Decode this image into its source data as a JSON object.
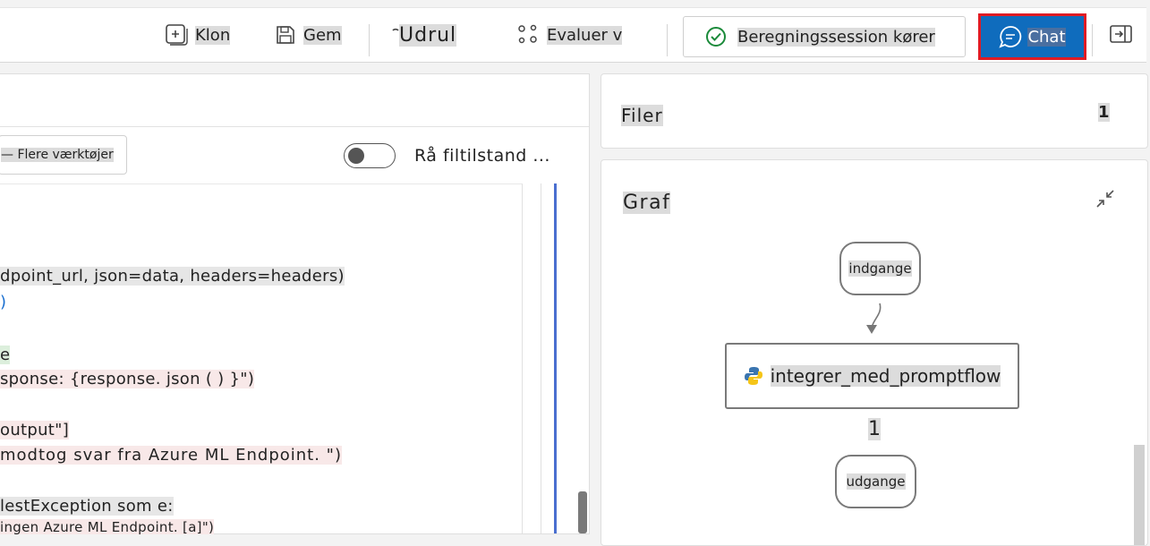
{
  "toolbar": {
    "clone_label": "Klon",
    "save_label": "Gem",
    "deploy_label": "Udrul",
    "evaluate_label": "Evaluer v",
    "session_label": "Beregningssession kører",
    "chat_label": "Chat"
  },
  "editor": {
    "more_tools_label": "— Flere værktøjer",
    "raw_file_label": "Rå filtilstand ...",
    "code_lines": [
      "dpoint_url, json=data, headers=headers)",
      ")",
      "e",
      "sponse: {response. json ( ) }\")",
      "output\"]",
      "modtog svar fra Azure ML Endpoint. \")",
      "lestException som e:",
      "ingen Azure ML Endpoint. [a]\")"
    ]
  },
  "files": {
    "title": "Filer",
    "count": "1"
  },
  "graph": {
    "title": "Graf",
    "input_node": "indgange",
    "main_node": "integrer_med_promptflow",
    "edge_count": "1",
    "output_node": "udgange"
  },
  "colors": {
    "accent": "#0f6cbd",
    "highlight_border": "#e01b24",
    "status_ok": "#1b8a3a"
  },
  "icons": [
    "clone-icon",
    "save-icon",
    "deploy-icon",
    "evaluate-icon",
    "check-circle-icon",
    "chat-icon",
    "panel-toggle-icon",
    "collapse-icon",
    "python-icon"
  ]
}
